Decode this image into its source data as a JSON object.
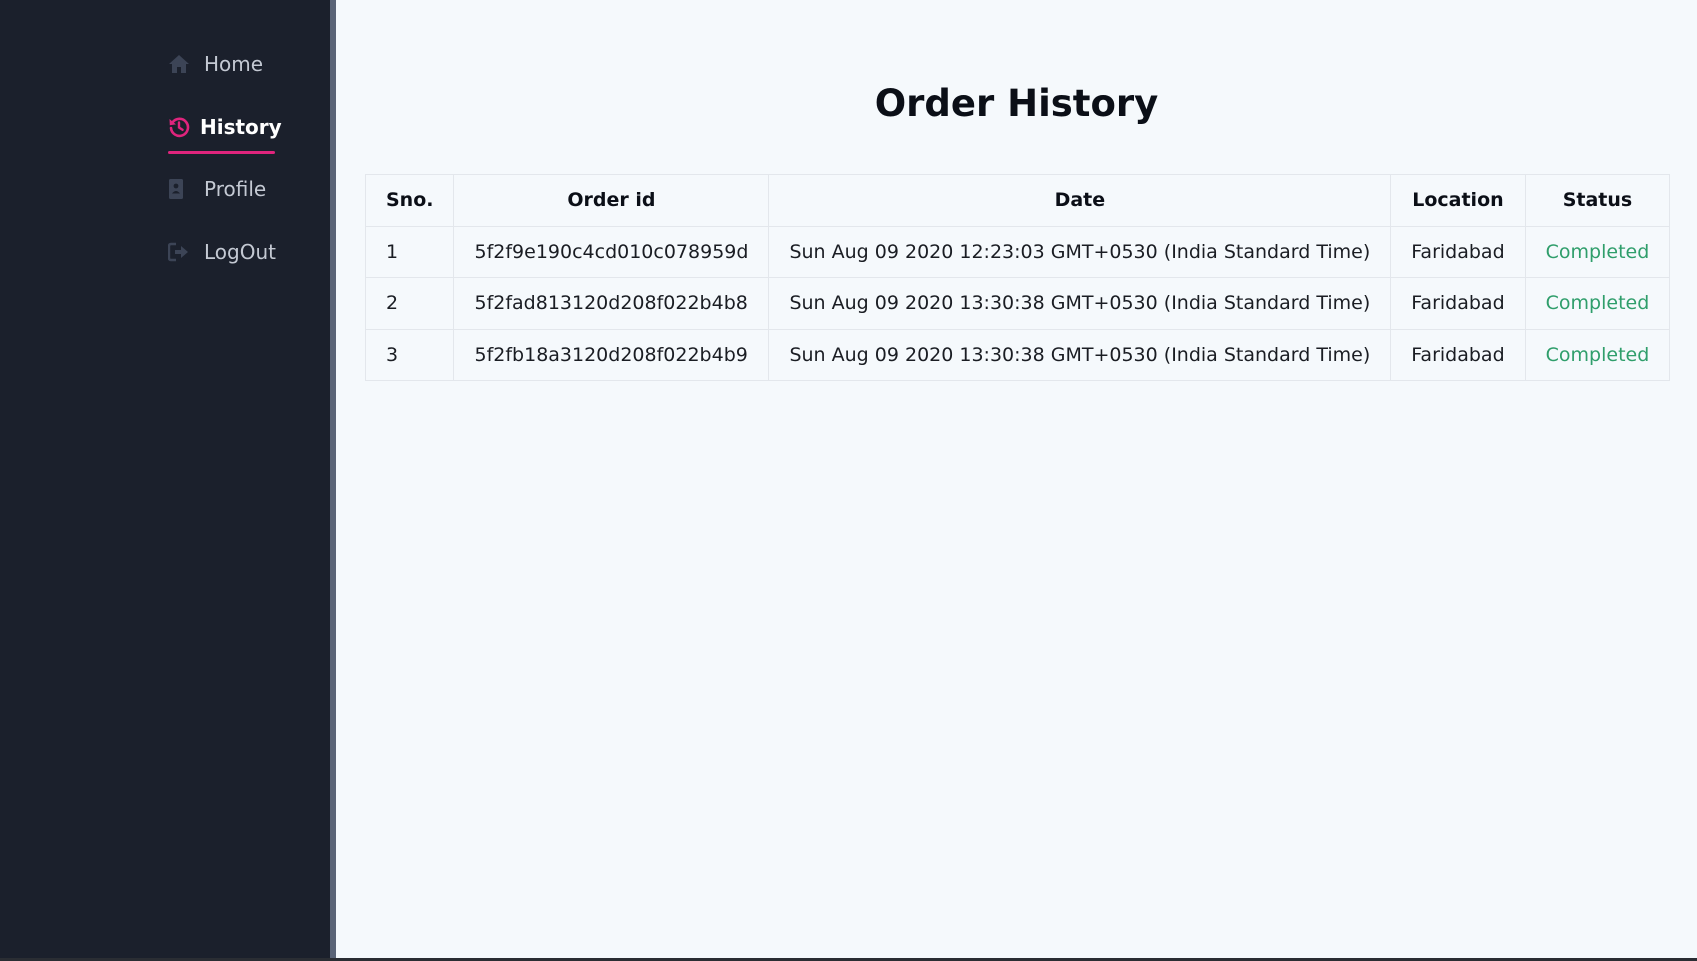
{
  "sidebar": {
    "items": [
      {
        "label": "Home",
        "icon": "home-icon"
      },
      {
        "label": "History",
        "icon": "history-icon"
      },
      {
        "label": "Profile",
        "icon": "profile-icon"
      },
      {
        "label": "LogOut",
        "icon": "logout-icon"
      }
    ],
    "active_item": "History",
    "accent_color": "#e0247d"
  },
  "main": {
    "title": "Order History",
    "table": {
      "headers": [
        "Sno.",
        "Order id",
        "Date",
        "Location",
        "Status"
      ],
      "rows": [
        {
          "sno": "1",
          "order_id": "5f2f9e190c4cd010c078959d",
          "date": "Sun Aug 09 2020 12:23:03 GMT+0530 (India Standard Time)",
          "location": "Faridabad",
          "status": "Completed"
        },
        {
          "sno": "2",
          "order_id": "5f2fad813120d208f022b4b8",
          "date": "Sun Aug 09 2020 13:30:38 GMT+0530 (India Standard Time)",
          "location": "Faridabad",
          "status": "Completed"
        },
        {
          "sno": "3",
          "order_id": "5f2fb18a3120d208f022b4b9",
          "date": "Sun Aug 09 2020 13:30:38 GMT+0530 (India Standard Time)",
          "location": "Faridabad",
          "status": "Completed"
        }
      ],
      "status_color": "#2f9e6b"
    }
  }
}
